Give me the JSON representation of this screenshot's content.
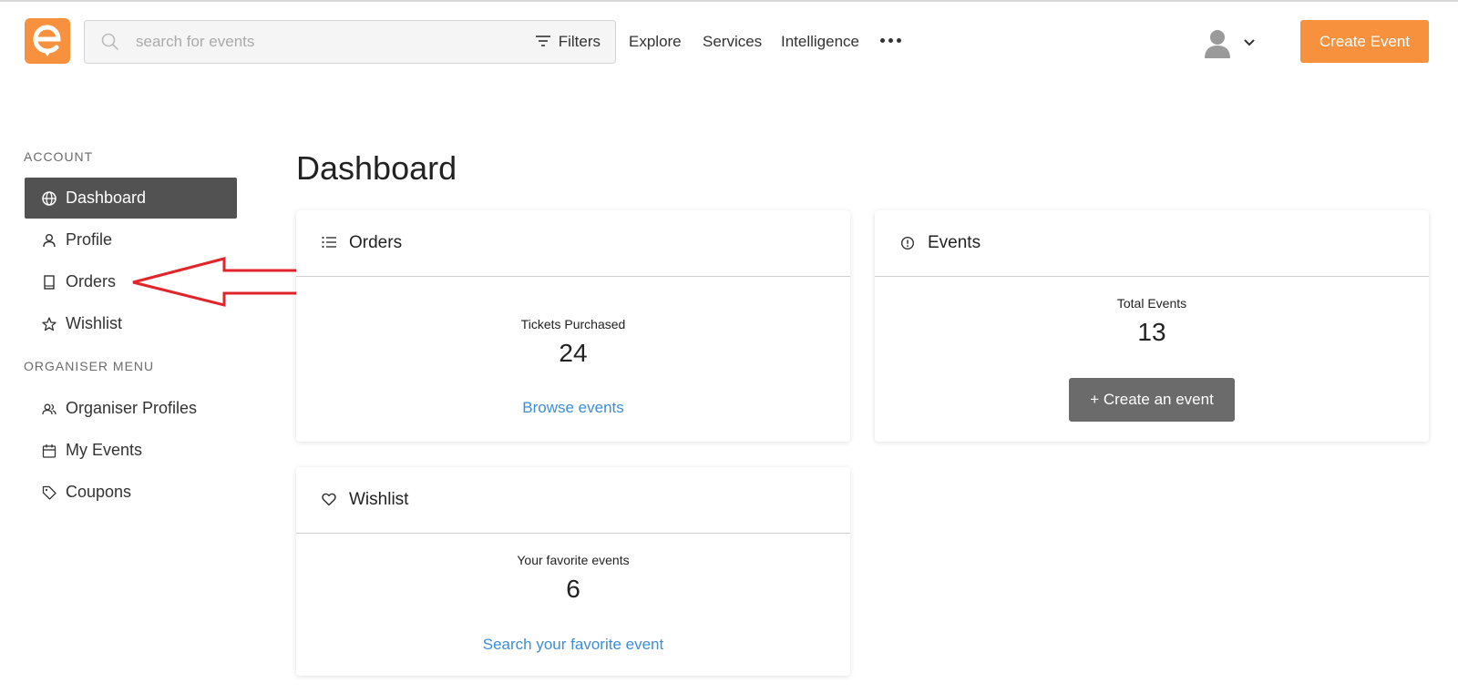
{
  "header": {
    "search_placeholder": "search for events",
    "filters_label": "Filters",
    "nav": [
      "Explore",
      "Services",
      "Intelligence"
    ],
    "create_event_label": "Create Event"
  },
  "sidebar": {
    "account_label": "ACCOUNT",
    "account_items": [
      {
        "label": "Dashboard",
        "icon": "globe-icon",
        "active": true
      },
      {
        "label": "Profile",
        "icon": "user-icon"
      },
      {
        "label": "Orders",
        "icon": "book-icon"
      },
      {
        "label": "Wishlist",
        "icon": "star-icon"
      }
    ],
    "organiser_label": "ORGANISER MENU",
    "organiser_items": [
      {
        "label": "Organiser Profiles",
        "icon": "users-icon"
      },
      {
        "label": "My Events",
        "icon": "calendar-icon"
      },
      {
        "label": "Coupons",
        "icon": "tag-icon"
      }
    ]
  },
  "main": {
    "title": "Dashboard",
    "orders": {
      "title": "Orders",
      "stat_label": "Tickets Purchased",
      "stat_value": "24",
      "link": "Browse events"
    },
    "events": {
      "title": "Events",
      "stat_label": "Total Events",
      "stat_value": "13",
      "button": "+ Create an event"
    },
    "wishlist": {
      "title": "Wishlist",
      "stat_label": "Your favorite events",
      "stat_value": "6",
      "link": "Search your favorite event"
    }
  },
  "colors": {
    "brand": "#f7913d",
    "active_nav": "#525252",
    "link": "#3e8dd8",
    "annotation_arrow": "#e0262b"
  }
}
